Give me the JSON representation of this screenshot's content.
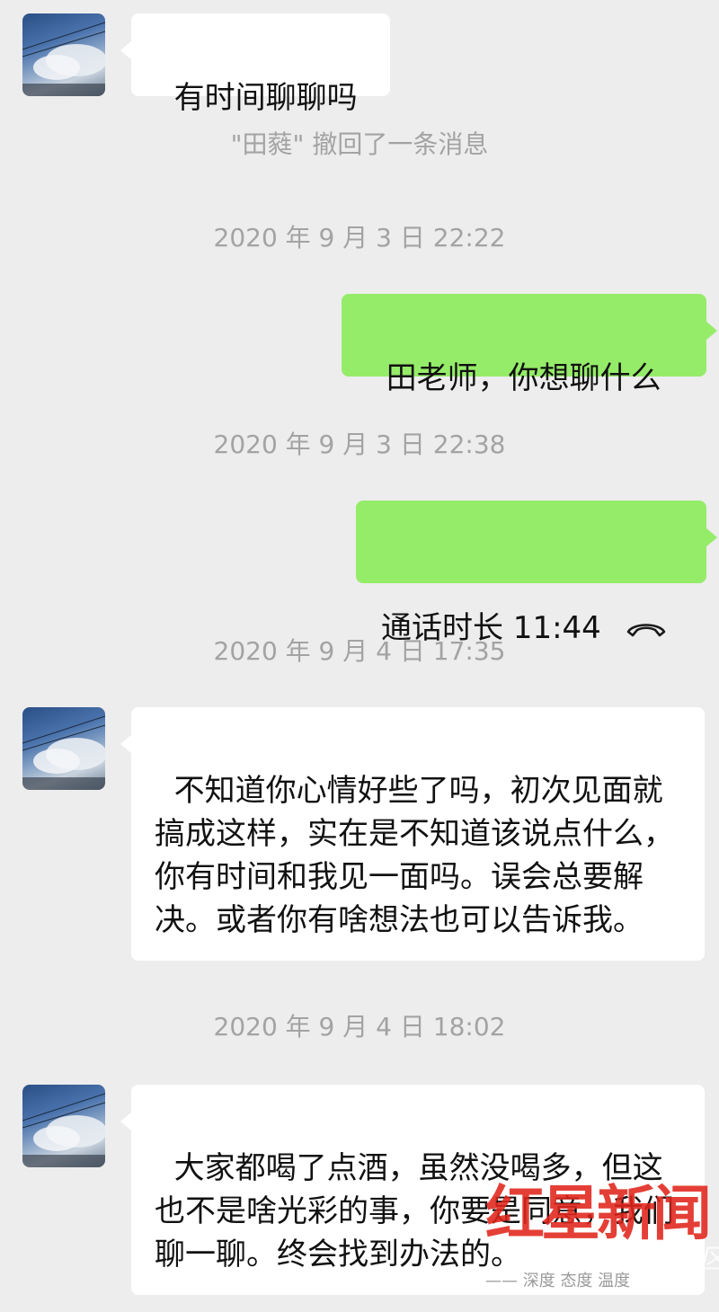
{
  "messages": {
    "m1": {
      "text": "有时间聊聊吗"
    },
    "recall_notice": "\"田蕤\" 撤回了一条消息",
    "t1": "2020 年 9 月 3 日 22:22",
    "m2": {
      "text": "田老师，你想聊什么"
    },
    "t2": "2020 年 9 月 3 日 22:38",
    "m3": {
      "call_label": "通话时长 11:44",
      "icon": "phone-hangup-icon"
    },
    "t3": "2020 年 9 月 4 日 17:35",
    "m4": {
      "text": "不知道你心情好些了吗，初次见面就搞成这样，实在是不知道该说点什么，你有时间和我见一面吗。误会总要解决。或者你有啥想法也可以告诉我。"
    },
    "t4": "2020 年 9 月 4 日 18:02",
    "m5": {
      "text": "大家都喝了点酒，虽然没喝多，但这也不是啥光彩的事，你要是同意，我们聊一聊。终会找到办法的。"
    }
  },
  "watermark": {
    "main": "红星新闻",
    "sub": "—— 深度 态度 温度",
    "site": "天涯社区"
  },
  "colors": {
    "background": "#ededed",
    "incoming_bubble": "#ffffff",
    "outgoing_bubble": "#95ec69",
    "meta_text": "#a3a3a3",
    "watermark_red": "#e1251b"
  }
}
